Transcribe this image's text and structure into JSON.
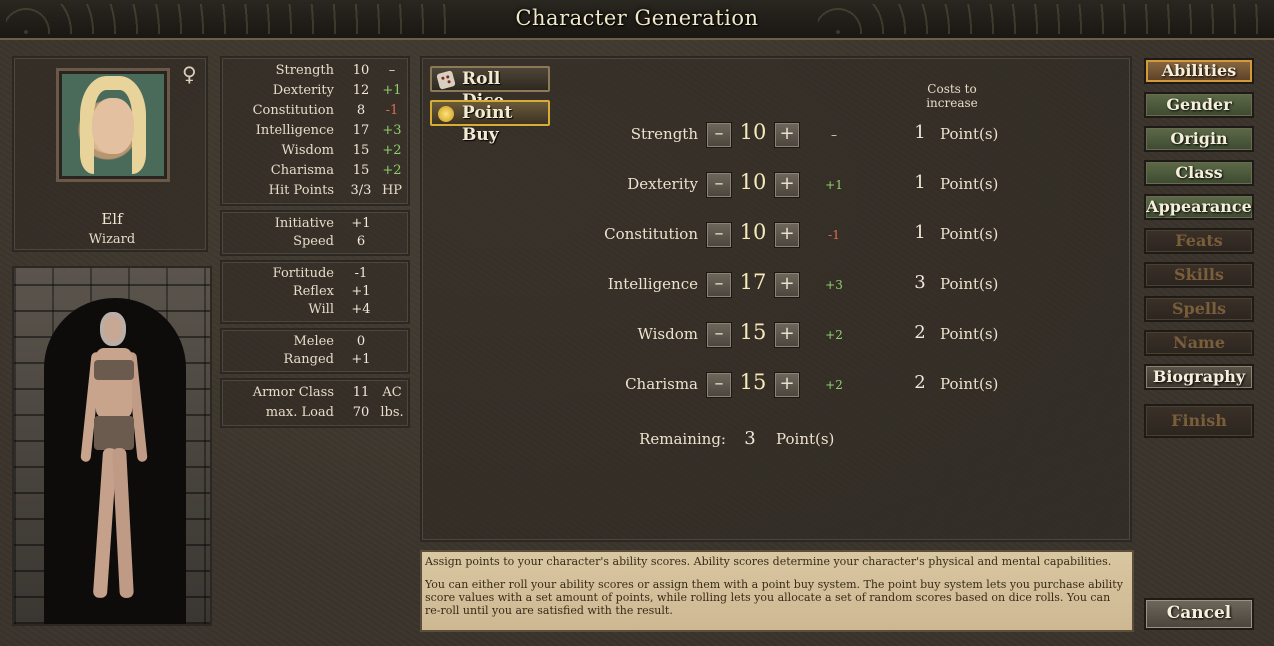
{
  "window": {
    "title": "Character Generation"
  },
  "character": {
    "race": "Elf",
    "class": "Wizard",
    "gender_icon": "female-symbol-icon",
    "gender_symbol": "♀"
  },
  "summary": {
    "abilities": [
      {
        "label": "Strength",
        "value": "10",
        "mod": "–",
        "tone": "neu"
      },
      {
        "label": "Dexterity",
        "value": "12",
        "mod": "+1",
        "tone": "pos"
      },
      {
        "label": "Constitution",
        "value": "8",
        "mod": "-1",
        "tone": "neg"
      },
      {
        "label": "Intelligence",
        "value": "17",
        "mod": "+3",
        "tone": "pos"
      },
      {
        "label": "Wisdom",
        "value": "15",
        "mod": "+2",
        "tone": "pos"
      },
      {
        "label": "Charisma",
        "value": "15",
        "mod": "+2",
        "tone": "pos"
      },
      {
        "label": "Hit Points",
        "value": "3/3",
        "mod": "HP",
        "tone": "neu"
      }
    ],
    "initiative": {
      "label": "Initiative",
      "value": "+1"
    },
    "speed": {
      "label": "Speed",
      "value": "6"
    },
    "fortitude": {
      "label": "Fortitude",
      "value": "-1"
    },
    "reflex": {
      "label": "Reflex",
      "value": "+1"
    },
    "will": {
      "label": "Will",
      "value": "+4"
    },
    "melee": {
      "label": "Melee",
      "value": "0"
    },
    "ranged": {
      "label": "Ranged",
      "value": "+1"
    },
    "armor_class": {
      "label": "Armor Class",
      "value": "11",
      "unit": "AC"
    },
    "max_load": {
      "label": "max. Load",
      "value": "70",
      "unit": "lbs."
    }
  },
  "modes": {
    "roll_dice": "Roll Dice",
    "point_buy": "Point Buy",
    "active": "point_buy"
  },
  "point_buy": {
    "costs_header": "Costs to increase",
    "minus_symbol": "–",
    "plus_symbol": "+",
    "rows": [
      {
        "name": "Strength",
        "score": "10",
        "mod": "–",
        "tone": "neu",
        "cost": "1",
        "unit": "Point(s)"
      },
      {
        "name": "Dexterity",
        "score": "10",
        "mod": "+1",
        "tone": "pos",
        "cost": "1",
        "unit": "Point(s)"
      },
      {
        "name": "Constitution",
        "score": "10",
        "mod": "-1",
        "tone": "neg",
        "cost": "1",
        "unit": "Point(s)"
      },
      {
        "name": "Intelligence",
        "score": "17",
        "mod": "+3",
        "tone": "pos",
        "cost": "3",
        "unit": "Point(s)"
      },
      {
        "name": "Wisdom",
        "score": "15",
        "mod": "+2",
        "tone": "pos",
        "cost": "2",
        "unit": "Point(s)"
      },
      {
        "name": "Charisma",
        "score": "15",
        "mod": "+2",
        "tone": "pos",
        "cost": "2",
        "unit": "Point(s)"
      }
    ],
    "remaining_label": "Remaining:",
    "remaining_value": "3",
    "remaining_unit": "Point(s)"
  },
  "description": {
    "p1": "Assign points to your character's ability scores. Ability scores determine your character's physical and mental capabilities.",
    "p2": "You can either roll your ability scores or assign them with a point buy system. The point buy system lets you purchase ability score values with a set amount of points, while rolling lets you allocate a set of random scores based on dice rolls. You can re-roll until you are satisfied with the result."
  },
  "nav": {
    "items": [
      {
        "label": "Abilities",
        "state": "current"
      },
      {
        "label": "Gender",
        "state": "done"
      },
      {
        "label": "Origin",
        "state": "done"
      },
      {
        "label": "Class",
        "state": "done"
      },
      {
        "label": "Appearance",
        "state": "done"
      },
      {
        "label": "Feats",
        "state": "disabled"
      },
      {
        "label": "Skills",
        "state": "disabled"
      },
      {
        "label": "Spells",
        "state": "disabled"
      },
      {
        "label": "Name",
        "state": "disabled"
      },
      {
        "label": "Biography",
        "state": "plain"
      }
    ],
    "finish": "Finish",
    "cancel": "Cancel"
  },
  "colors": {
    "positive": "#8fd06a",
    "negative": "#e06a55",
    "nav_done": "#4e5c3c",
    "nav_current_border": "#d49a3a",
    "description_bg": "#d4c29c"
  }
}
